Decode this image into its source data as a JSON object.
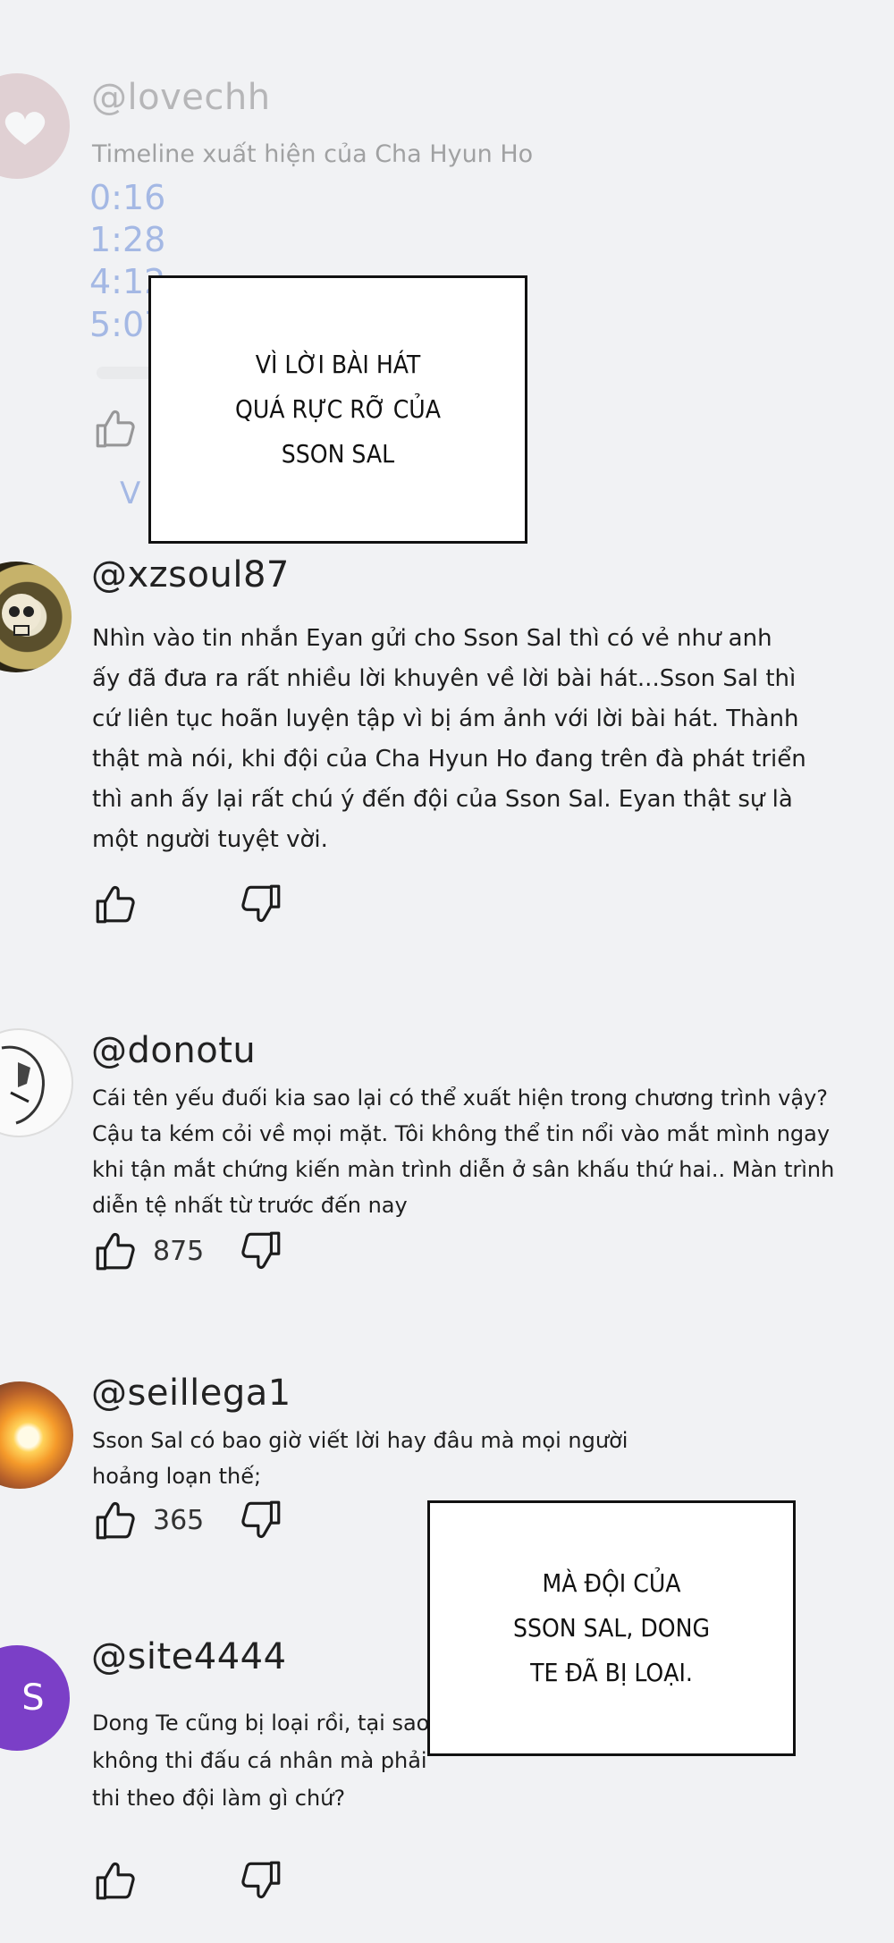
{
  "comments": [
    {
      "handle": "@lovechh",
      "text": "Timeline xuất hiện của Cha Hyun Ho",
      "timestamps": [
        "0:16",
        "1:28",
        "4:12",
        "5:07"
      ]
    },
    {
      "handle": "@xzsoul87",
      "text": "Nhìn vào tin nhắn Eyan gửi cho Sson Sal thì có vẻ như anh\nấy đã đưa ra rất nhiều lời khuyên về lời bài hát...Sson Sal thì\ncứ liên tục hoãn luyện tập vì bị ám ảnh với lời bài hát. Thành\nthật mà nói, khi đội của Cha Hyun Ho đang trên đà phát triển\nthì anh ấy lại rất chú ý đến đội của Sson Sal. Eyan thật sự là\nmột người tuyệt vời."
    },
    {
      "handle": "@donotu",
      "text": "Cái tên yếu đuối kia sao lại có thể xuất hiện trong chương trình vậy?\nCậu ta kém cỏi về mọi mặt. Tôi không thể tin nổi vào mắt mình ngay\nkhi tận mắt chứng kiến màn trình diễn ở sân khấu thứ hai.. Màn trình\ndiễn tệ nhất từ trước đến nay",
      "likes": "875"
    },
    {
      "handle": "@seillega1",
      "text": "Sson Sal có bao giờ viết lời hay đâu mà mọi người\nhoảng loạn thế;",
      "likes": "365"
    },
    {
      "handle": "@site4444",
      "avatar_letter": "S",
      "text": "Dong Te cũng bị loại rồi, tại sao\nkhông thi đấu cá nhân mà phải\nthi theo đội làm gì chứ?"
    }
  ],
  "overlays": [
    {
      "text": "VÌ LỜI BÀI HÁT\nQUÁ RỰC RỠ CỦA\nSSON SAL"
    },
    {
      "text": "MÀ ĐỘI CỦA\nSSON SAL, DONG\nTE ĐÃ BỊ LOẠI."
    }
  ],
  "reply_toggle": "V",
  "icons": {
    "like": "thumbs-up-icon",
    "dislike": "thumbs-down-icon",
    "avatar_heart": "heart-icon"
  },
  "colors": {
    "link": "#3b6ad0",
    "avatar_s": "#7b3fc7",
    "background": "#f1f2f4"
  }
}
